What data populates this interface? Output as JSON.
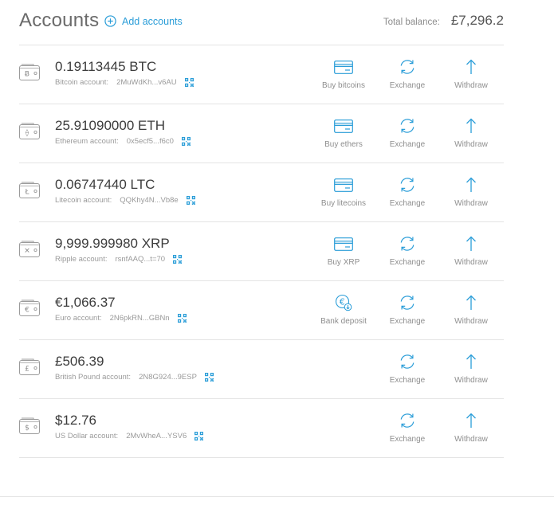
{
  "header": {
    "title": "Accounts",
    "add_accounts_label": "Add accounts",
    "add_accounts_icon": "plus-circle-icon",
    "total_label": "Total balance:",
    "total_value": "£7,296.2"
  },
  "colors": {
    "accent": "#2a9dd8",
    "text_muted": "#9a9a9a",
    "divider": "#e4e4e4"
  },
  "accounts": [
    {
      "currency_symbol": "Ƀ",
      "amount": "0.19113445 BTC",
      "account_label": "Bitcoin account:",
      "address": "2MuWdKh...v6AU",
      "buy_label": "Buy bitcoins",
      "buy_icon": "credit-card-icon"
    },
    {
      "currency_symbol": "⟠",
      "amount": "25.91090000 ETH",
      "account_label": "Ethereum account:",
      "address": "0x5ecf5...f6c0",
      "buy_label": "Buy ethers",
      "buy_icon": "credit-card-icon"
    },
    {
      "currency_symbol": "Ł",
      "amount": "0.06747440 LTC",
      "account_label": "Litecoin account:",
      "address": "QQKhy4N...Vb8e",
      "buy_label": "Buy litecoins",
      "buy_icon": "credit-card-icon"
    },
    {
      "currency_symbol": "✕",
      "amount": "9,999.999980 XRP",
      "account_label": "Ripple account:",
      "address": "rsnfAAQ...t=70",
      "buy_label": "Buy XRP",
      "buy_icon": "credit-card-icon"
    },
    {
      "currency_symbol": "€",
      "amount": "€1,066.37",
      "account_label": "Euro account:",
      "address": "2N6pkRN...GBNn",
      "buy_label": "Bank deposit",
      "buy_icon": "euro-deposit-icon"
    },
    {
      "currency_symbol": "£",
      "amount": "£506.39",
      "account_label": "British Pound account:",
      "address": "2N8G924...9ESP"
    },
    {
      "currency_symbol": "$",
      "amount": "$12.76",
      "account_label": "US Dollar account:",
      "address": "2MvWheA...YSV6"
    }
  ],
  "actions": {
    "exchange_label": "Exchange",
    "exchange_icon": "exchange-arrows-icon",
    "withdraw_label": "Withdraw",
    "withdraw_icon": "arrow-up-icon",
    "qr_icon": "qr-code-icon",
    "wallet_icon": "wallet-icon"
  }
}
